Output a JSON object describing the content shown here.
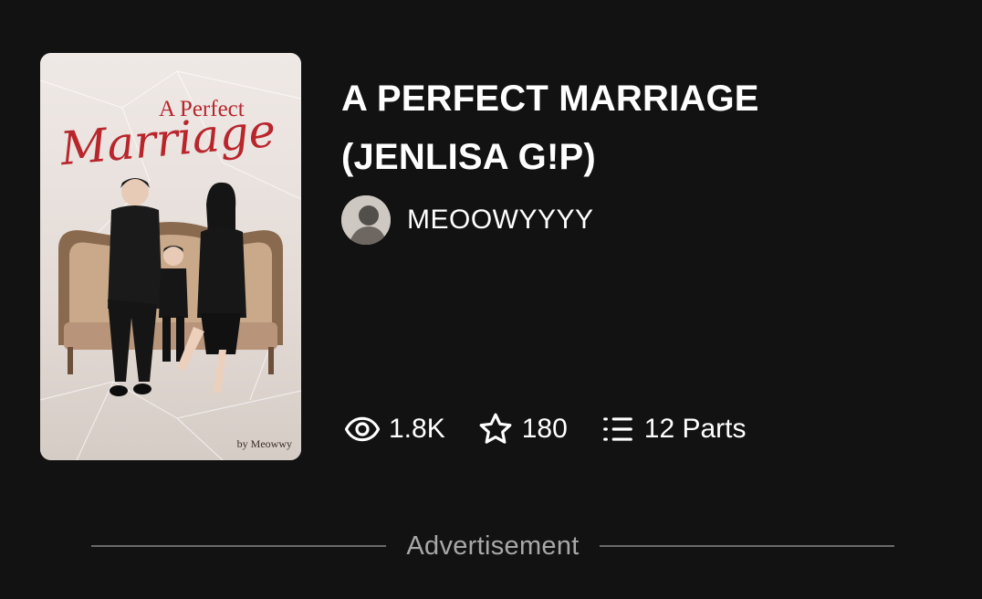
{
  "story": {
    "title_line1": "A PERFECT MARRIAGE",
    "title_line2": "(JENLISA G!P)",
    "cover": {
      "title_top": "A Perfect",
      "title_script": "Marriage",
      "byline": "by Meowwy"
    },
    "author": {
      "name": "MEOOWYYYY"
    },
    "stats": {
      "reads": "1.8K",
      "votes": "180",
      "parts": "12 Parts"
    }
  },
  "advertisement": {
    "label": "Advertisement"
  },
  "colors": {
    "background": "#121212",
    "text": "#ffffff",
    "muted": "#a8a8a8",
    "cover_title_red": "#b8262c"
  },
  "icons": {
    "reads": "eye-icon",
    "votes": "star-icon",
    "parts": "list-icon"
  }
}
